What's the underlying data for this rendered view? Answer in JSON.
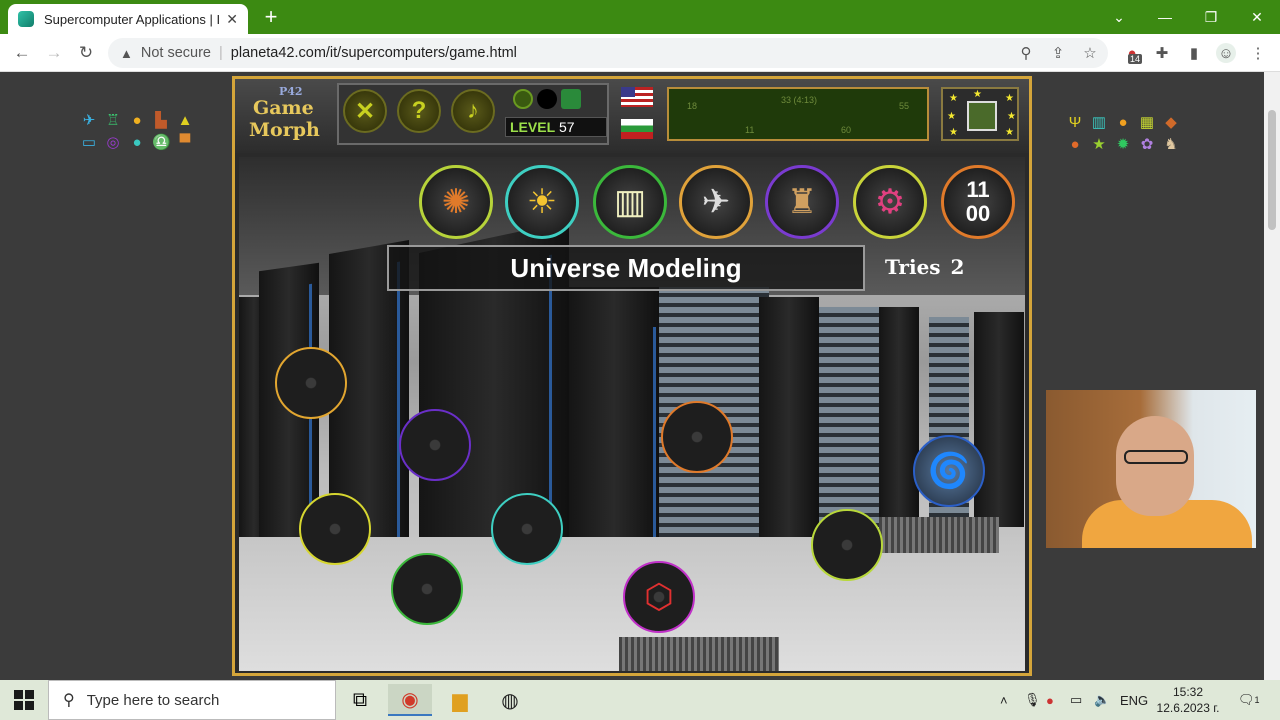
{
  "browser": {
    "tab_title": "Supercomputer Applications | IT",
    "tab_close": "✕",
    "new_tab": "+",
    "not_secure": "Not secure",
    "url": "planeta42.com/it/supercomputers/game.html",
    "extension_badge": "14"
  },
  "game": {
    "logo_tag": "P42",
    "logo_line1": "Game",
    "logo_line2": "Morph",
    "help_label": "?",
    "level_label": "LEVEL",
    "level_value": "57",
    "key_counter_top": "11",
    "key_counter_bottom": "00",
    "title": "Universe Modeling",
    "tries_label": "Tries",
    "tries_value": "2",
    "scoreboard": {
      "left_value": "18",
      "right_value": "55",
      "mid_top": "33 (4:13)",
      "bottom_values": [
        "11",
        "60"
      ]
    },
    "top_icons": [
      {
        "name": "explosion-icon",
        "border": "#b7d33a"
      },
      {
        "name": "weather-icon",
        "border": "#3ecfc2"
      },
      {
        "name": "solar-panel-icon",
        "border": "#3bb83b"
      },
      {
        "name": "rocket-icon",
        "border": "#e0a23a"
      },
      {
        "name": "oil-rig-icon",
        "border": "#7a3bd0"
      },
      {
        "name": "gears-icon",
        "border": "#c9d43a"
      },
      {
        "name": "key-icon",
        "border": "#e07a2a"
      }
    ],
    "slots": [
      {
        "name": "slot-orange-1",
        "border": "#e2a630"
      },
      {
        "name": "slot-purple",
        "border": "#6a2fc8"
      },
      {
        "name": "slot-orange-2",
        "border": "#e07a2a"
      },
      {
        "name": "slot-tornado",
        "border": "#2a5fc8",
        "icon": "tornado-icon"
      },
      {
        "name": "slot-yellow-1",
        "border": "#d6d630"
      },
      {
        "name": "slot-teal",
        "border": "#3ecfc2"
      },
      {
        "name": "slot-yellow-2",
        "border": "#b8d83a"
      },
      {
        "name": "slot-green",
        "border": "#3bb83b"
      },
      {
        "name": "slot-molecule",
        "border": "#c030c8",
        "icon": "molecule-icon"
      }
    ]
  },
  "taskbar": {
    "search_placeholder": "Type here to search",
    "language": "ENG",
    "time": "15:32",
    "date": "12.6.2023 г.",
    "notification_count": "1"
  },
  "colors": {
    "tab_strip": "#3c8a12",
    "game_border": "#d4a53a",
    "level_green": "#9ce04a"
  }
}
